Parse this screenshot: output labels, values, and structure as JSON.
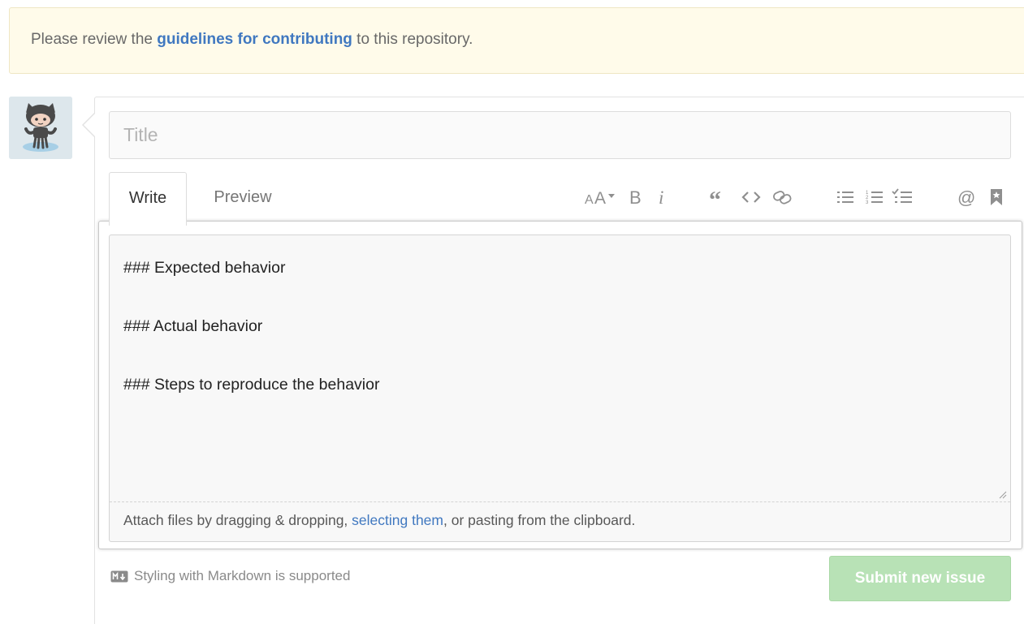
{
  "notice": {
    "before": "Please review the ",
    "link": "guidelines for contributing",
    "after": " to this repository."
  },
  "avatar": {
    "icon": "octocat-icon"
  },
  "form": {
    "title_placeholder": "Title",
    "tabs": [
      {
        "label": "Write",
        "active": true
      },
      {
        "label": "Preview",
        "active": false
      }
    ],
    "toolbar": [
      {
        "icon": "text-size-icon",
        "glyph": "AA▾"
      },
      {
        "icon": "bold-icon",
        "glyph": "B"
      },
      {
        "icon": "italic-icon",
        "glyph": "i"
      },
      {
        "icon": "quote-icon",
        "glyph": "“"
      },
      {
        "icon": "code-icon",
        "glyph": "‹›"
      },
      {
        "icon": "link-icon",
        "glyph": "⊂⊃"
      },
      {
        "icon": "unordered-list-icon",
        "glyph": "☰"
      },
      {
        "icon": "ordered-list-icon",
        "glyph": "☰"
      },
      {
        "icon": "task-list-icon",
        "glyph": "✓☰"
      },
      {
        "icon": "mention-icon",
        "glyph": "@"
      },
      {
        "icon": "reference-icon",
        "glyph": "bookmark"
      }
    ],
    "body_text": "### Expected behavior\n\n### Actual behavior\n\n### Steps to reproduce the behavior",
    "attach": {
      "before": "Attach files by dragging & dropping, ",
      "link": "selecting them",
      "after": ", or pasting from the clipboard."
    },
    "markdown_note": "Styling with Markdown is supported",
    "submit_label": "Submit new issue"
  },
  "colors": {
    "link": "#4078c0",
    "notice_background": "#fffbea",
    "submit_disabled": "#b8e2b6"
  }
}
